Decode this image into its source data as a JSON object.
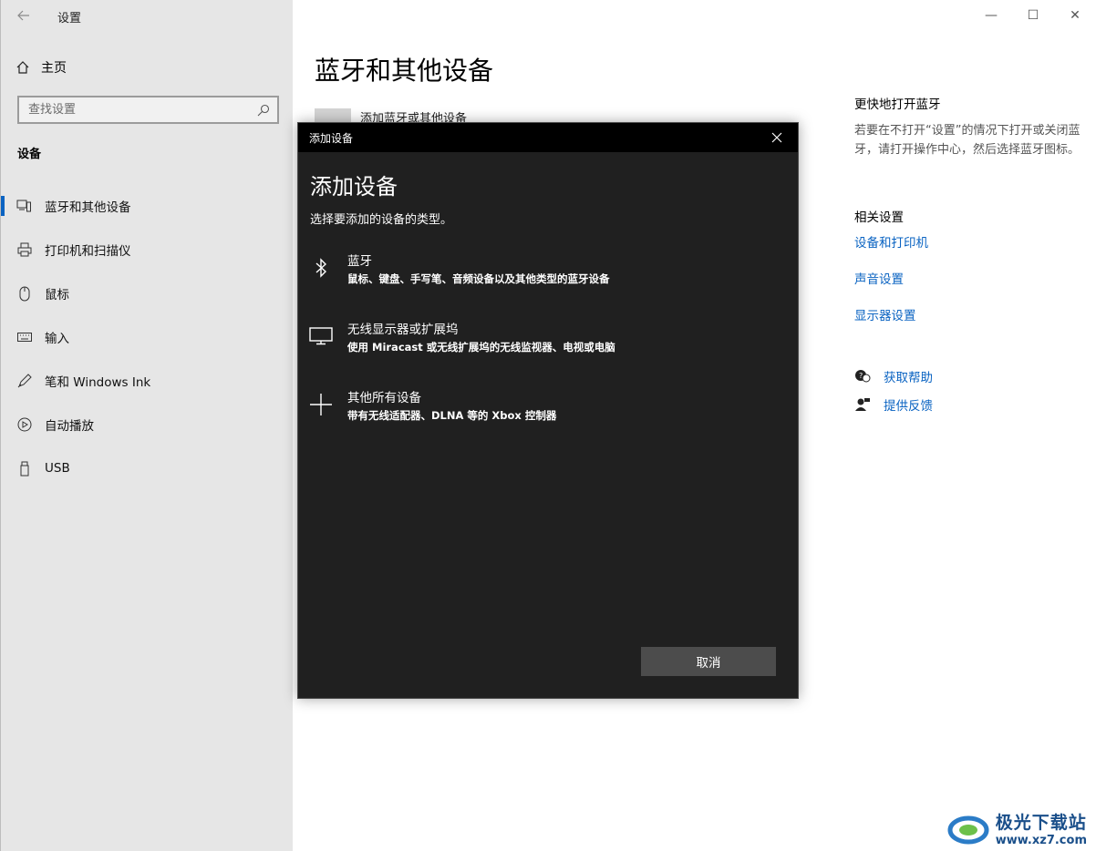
{
  "window": {
    "title": "设置",
    "controls": {
      "minimize": "—",
      "maximize": "☐",
      "close": "✕"
    }
  },
  "sidebar": {
    "home_label": "主页",
    "search_placeholder": "查找设置",
    "section_title": "设备",
    "items": [
      {
        "label": "蓝牙和其他设备",
        "icon": "bluetooth-devices-icon",
        "active": true
      },
      {
        "label": "打印机和扫描仪",
        "icon": "printer-icon",
        "active": false
      },
      {
        "label": "鼠标",
        "icon": "mouse-icon",
        "active": false
      },
      {
        "label": "输入",
        "icon": "keyboard-icon",
        "active": false
      },
      {
        "label": "笔和 Windows Ink",
        "icon": "pen-icon",
        "active": false
      },
      {
        "label": "自动播放",
        "icon": "autoplay-icon",
        "active": false
      },
      {
        "label": "USB",
        "icon": "usb-icon",
        "active": false
      }
    ]
  },
  "main": {
    "title": "蓝牙和其他设备",
    "add_device_label": "添加蓝牙或其他设备"
  },
  "right_panel": {
    "quick_title": "更快地打开蓝牙",
    "quick_desc": "若要在不打开“设置”的情况下打开或关闭蓝牙，请打开操作中心，然后选择蓝牙图标。",
    "related_title": "相关设置",
    "links": [
      "设备和打印机",
      "声音设置",
      "显示器设置"
    ],
    "help": "获取帮助",
    "feedback": "提供反馈"
  },
  "dialog": {
    "titlebar": "添加设备",
    "heading": "添加设备",
    "subtitle": "选择要添加的设备的类型。",
    "options": [
      {
        "title": "蓝牙",
        "desc": "鼠标、键盘、手写笔、音频设备以及其他类型的蓝牙设备",
        "icon": "bluetooth-icon"
      },
      {
        "title": "无线显示器或扩展坞",
        "desc": "使用 Miracast 或无线扩展坞的无线监视器、电视或电脑",
        "icon": "monitor-icon"
      },
      {
        "title": "其他所有设备",
        "desc": "带有无线适配器、DLNA 等的 Xbox 控制器",
        "icon": "plus-icon"
      }
    ],
    "cancel_label": "取消"
  },
  "watermark": {
    "title": "极光下载站",
    "url": "www.xz7.com"
  },
  "colors": {
    "accent": "#0a63c2",
    "dialog_bg": "#202020",
    "sidebar_bg": "#e6e6e6"
  }
}
